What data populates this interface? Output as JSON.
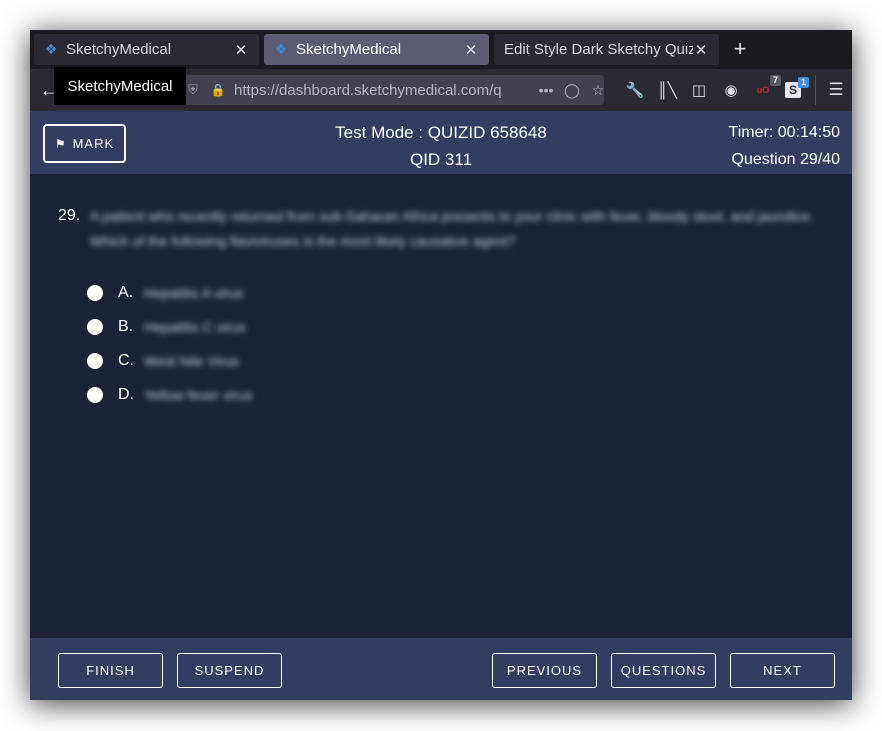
{
  "browser": {
    "tabs": [
      {
        "label": "SketchyMedical",
        "active": false,
        "icon": "figure-favicon"
      },
      {
        "label": "SketchyMedical",
        "active": true,
        "icon": "figure-favicon"
      },
      {
        "label": "Edit Style Dark Sketchy Quiz",
        "active": false
      }
    ],
    "url": "https://dashboard.sketchymedical.com/q",
    "tooltip": "SketchyMedical",
    "ublock_badge": "7",
    "stylus_badge": "1",
    "stylus_letter": "S",
    "ublock_letter": "uO"
  },
  "quiz": {
    "mark_label": "MARK",
    "title_line1": "Test Mode : QUIZID 658648",
    "title_line2": "QID 311",
    "timer": "Timer: 00:14:50",
    "question_counter": "Question 29/40",
    "question_number": "29.",
    "question_text": "A patient who recently returned from sub-Saharan Africa presents to your clinic with fever, bloody stool, and jaundice. Which of the following flaviviruses is the most likely causative agent?",
    "options": [
      {
        "letter": "A.",
        "text": "Hepatitis A virus"
      },
      {
        "letter": "B.",
        "text": "Hepatitis C virus"
      },
      {
        "letter": "C.",
        "text": "West Nile Virus"
      },
      {
        "letter": "D.",
        "text": "Yellow fever virus"
      }
    ]
  },
  "footer": {
    "finish": "FINISH",
    "suspend": "SUSPEND",
    "previous": "PREVIOUS",
    "questions": "QUESTIONS",
    "next": "NEXT"
  },
  "colors": {
    "page_bg": "#1c2237",
    "header_bg": "#333d62",
    "active_tab": "#5d5b73"
  }
}
